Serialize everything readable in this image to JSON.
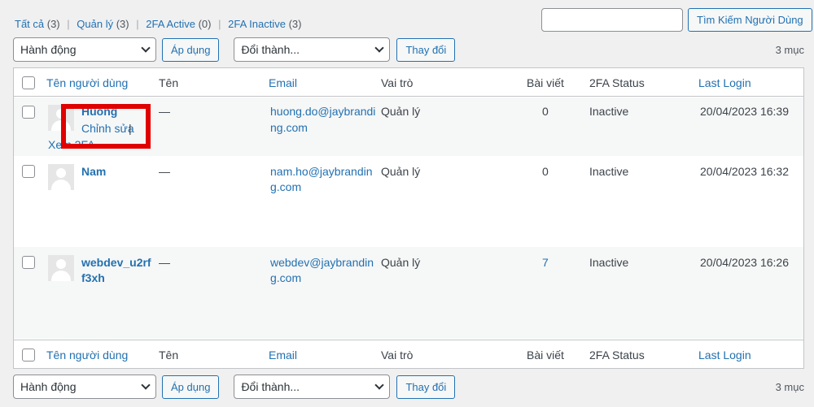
{
  "filters": [
    {
      "label": "Tất cả",
      "count": "(3)"
    },
    {
      "label": "Quản lý",
      "count": "(3)"
    },
    {
      "label": "2FA Active",
      "count": "(0)"
    },
    {
      "label": "2FA Inactive",
      "count": "(3)"
    }
  ],
  "search": {
    "button": "Tìm Kiếm Người Dùng",
    "value": ""
  },
  "nav": {
    "bulk_action": "Hành động",
    "apply": "Áp dụng",
    "change_role": "Đổi thành...",
    "change": "Thay đổi",
    "items_count": "3 mục"
  },
  "columns": {
    "username": "Tên người dùng",
    "name": "Tên",
    "email": "Email",
    "role": "Vai trò",
    "posts": "Bài viết",
    "status_2fa": "2FA Status",
    "last_login": "Last Login"
  },
  "users": [
    {
      "username": "Huong",
      "name": "—",
      "email_l1": "huong.do@jaybrandi",
      "email_l2": "ng.com",
      "role": "Quản lý",
      "posts": "0",
      "status": "Inactive",
      "last_login": "20/04/2023 16:39",
      "row_actions": {
        "edit": "Chỉnh sửa",
        "sep": "|",
        "view": "Xem 2FA"
      }
    },
    {
      "username": "Nam",
      "name": "—",
      "email_l1": "nam.ho@jaybrandin",
      "email_l2": "g.com",
      "role": "Quản lý",
      "posts": "0",
      "status": "Inactive",
      "last_login": "20/04/2023 16:32"
    },
    {
      "username_l1": "webdev_u2rf",
      "username_l2": "f3xh",
      "name": "—",
      "email_l1": "webdev@jaybrandin",
      "email_l2": "g.com",
      "role": "Quản lý",
      "posts": "7",
      "status": "Inactive",
      "last_login": "20/04/2023 16:26"
    }
  ]
}
